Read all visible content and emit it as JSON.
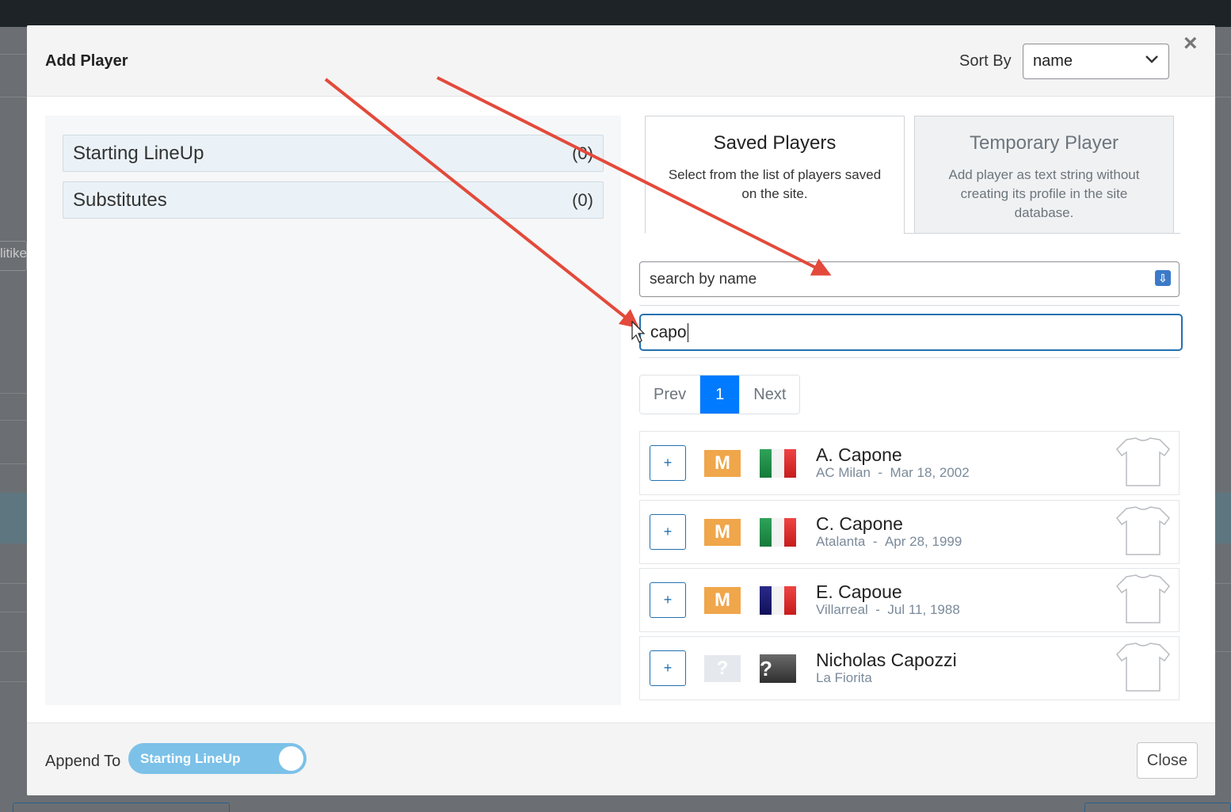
{
  "backdrop": {
    "fragment_text": "litike"
  },
  "modal": {
    "title": "Add Player",
    "sort_label": "Sort By",
    "sort_value": "name",
    "close_icon": "×"
  },
  "groups": [
    {
      "label": "Starting LineUp",
      "count": "(0)"
    },
    {
      "label": "Substitutes",
      "count": "(0)"
    }
  ],
  "tabs": [
    {
      "title": "Saved Players",
      "desc": "Select from the list of players saved on the site."
    },
    {
      "title": "Temporary Player",
      "desc": "Add player as text string without creating its profile in the site database."
    }
  ],
  "search": {
    "type_value": "search by name",
    "query": "capo"
  },
  "pagination": {
    "prev": "Prev",
    "current": "1",
    "next": "Next"
  },
  "players": [
    {
      "name": "A. Capone",
      "club": "AC Milan",
      "sep": "-",
      "dob": "Mar 18, 2002",
      "position": "M",
      "flag": "italy-flag",
      "add": "+"
    },
    {
      "name": "C. Capone",
      "club": "Atalanta",
      "sep": "-",
      "dob": "Apr 28, 1999",
      "position": "M",
      "flag": "italy-flag",
      "add": "+"
    },
    {
      "name": "E. Capoue",
      "club": "Villarreal",
      "sep": "-",
      "dob": "Jul 11, 1988",
      "position": "M",
      "flag": "france-flag",
      "add": "+"
    },
    {
      "name": "Nicholas Capozzi",
      "club": "La Fiorita",
      "sep": "",
      "dob": "",
      "position": "?",
      "flag": "?",
      "add": "+"
    }
  ],
  "footer": {
    "append_label": "Append To",
    "toggle_value": "Starting LineUp",
    "close_label": "Close"
  },
  "colors": {
    "accent": "#007bff",
    "wp_blue": "#2271b1",
    "position_badge": "#f0a64a",
    "toggle": "#7cc1e8",
    "annotation_arrow": "#e34a3b"
  }
}
